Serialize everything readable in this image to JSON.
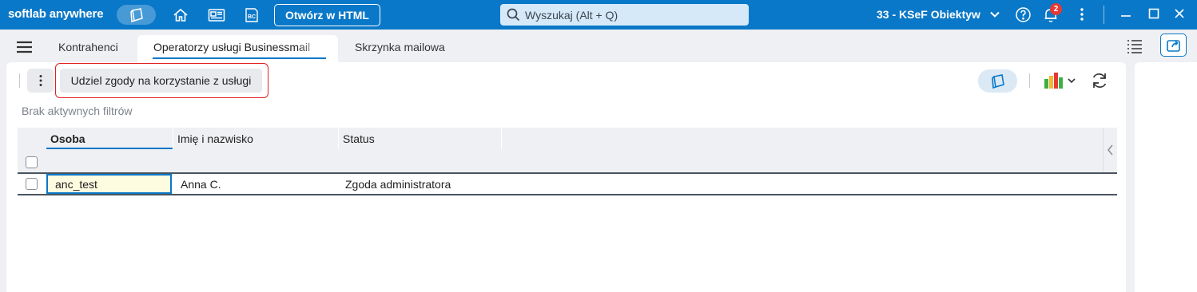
{
  "app": {
    "brand": "softlab anywhere",
    "open_html_label": "Otwórz w HTML",
    "search_placeholder": "Wyszukaj (Alt + Q)",
    "company": "33 - KSeF Obiektyw",
    "notifications_count": "2",
    "accent_color": "#0a78c8"
  },
  "tabs": [
    {
      "label": "Kontrahenci"
    },
    {
      "label": "Operatorzy usługi Businessmail"
    },
    {
      "label": "Skrzynka mailowa"
    }
  ],
  "toolbar": {
    "grant_button_label": "Udziel zgody na korzystanie z usługi"
  },
  "filters": {
    "text": "Brak aktywnych filtrów"
  },
  "grid": {
    "columns": [
      "Osoba",
      "Imię i nazwisko",
      "Status"
    ],
    "rows": [
      {
        "osoba": "anc_test",
        "imie_nazwisko": "Anna C.",
        "status": "Zgoda administratora"
      }
    ]
  }
}
